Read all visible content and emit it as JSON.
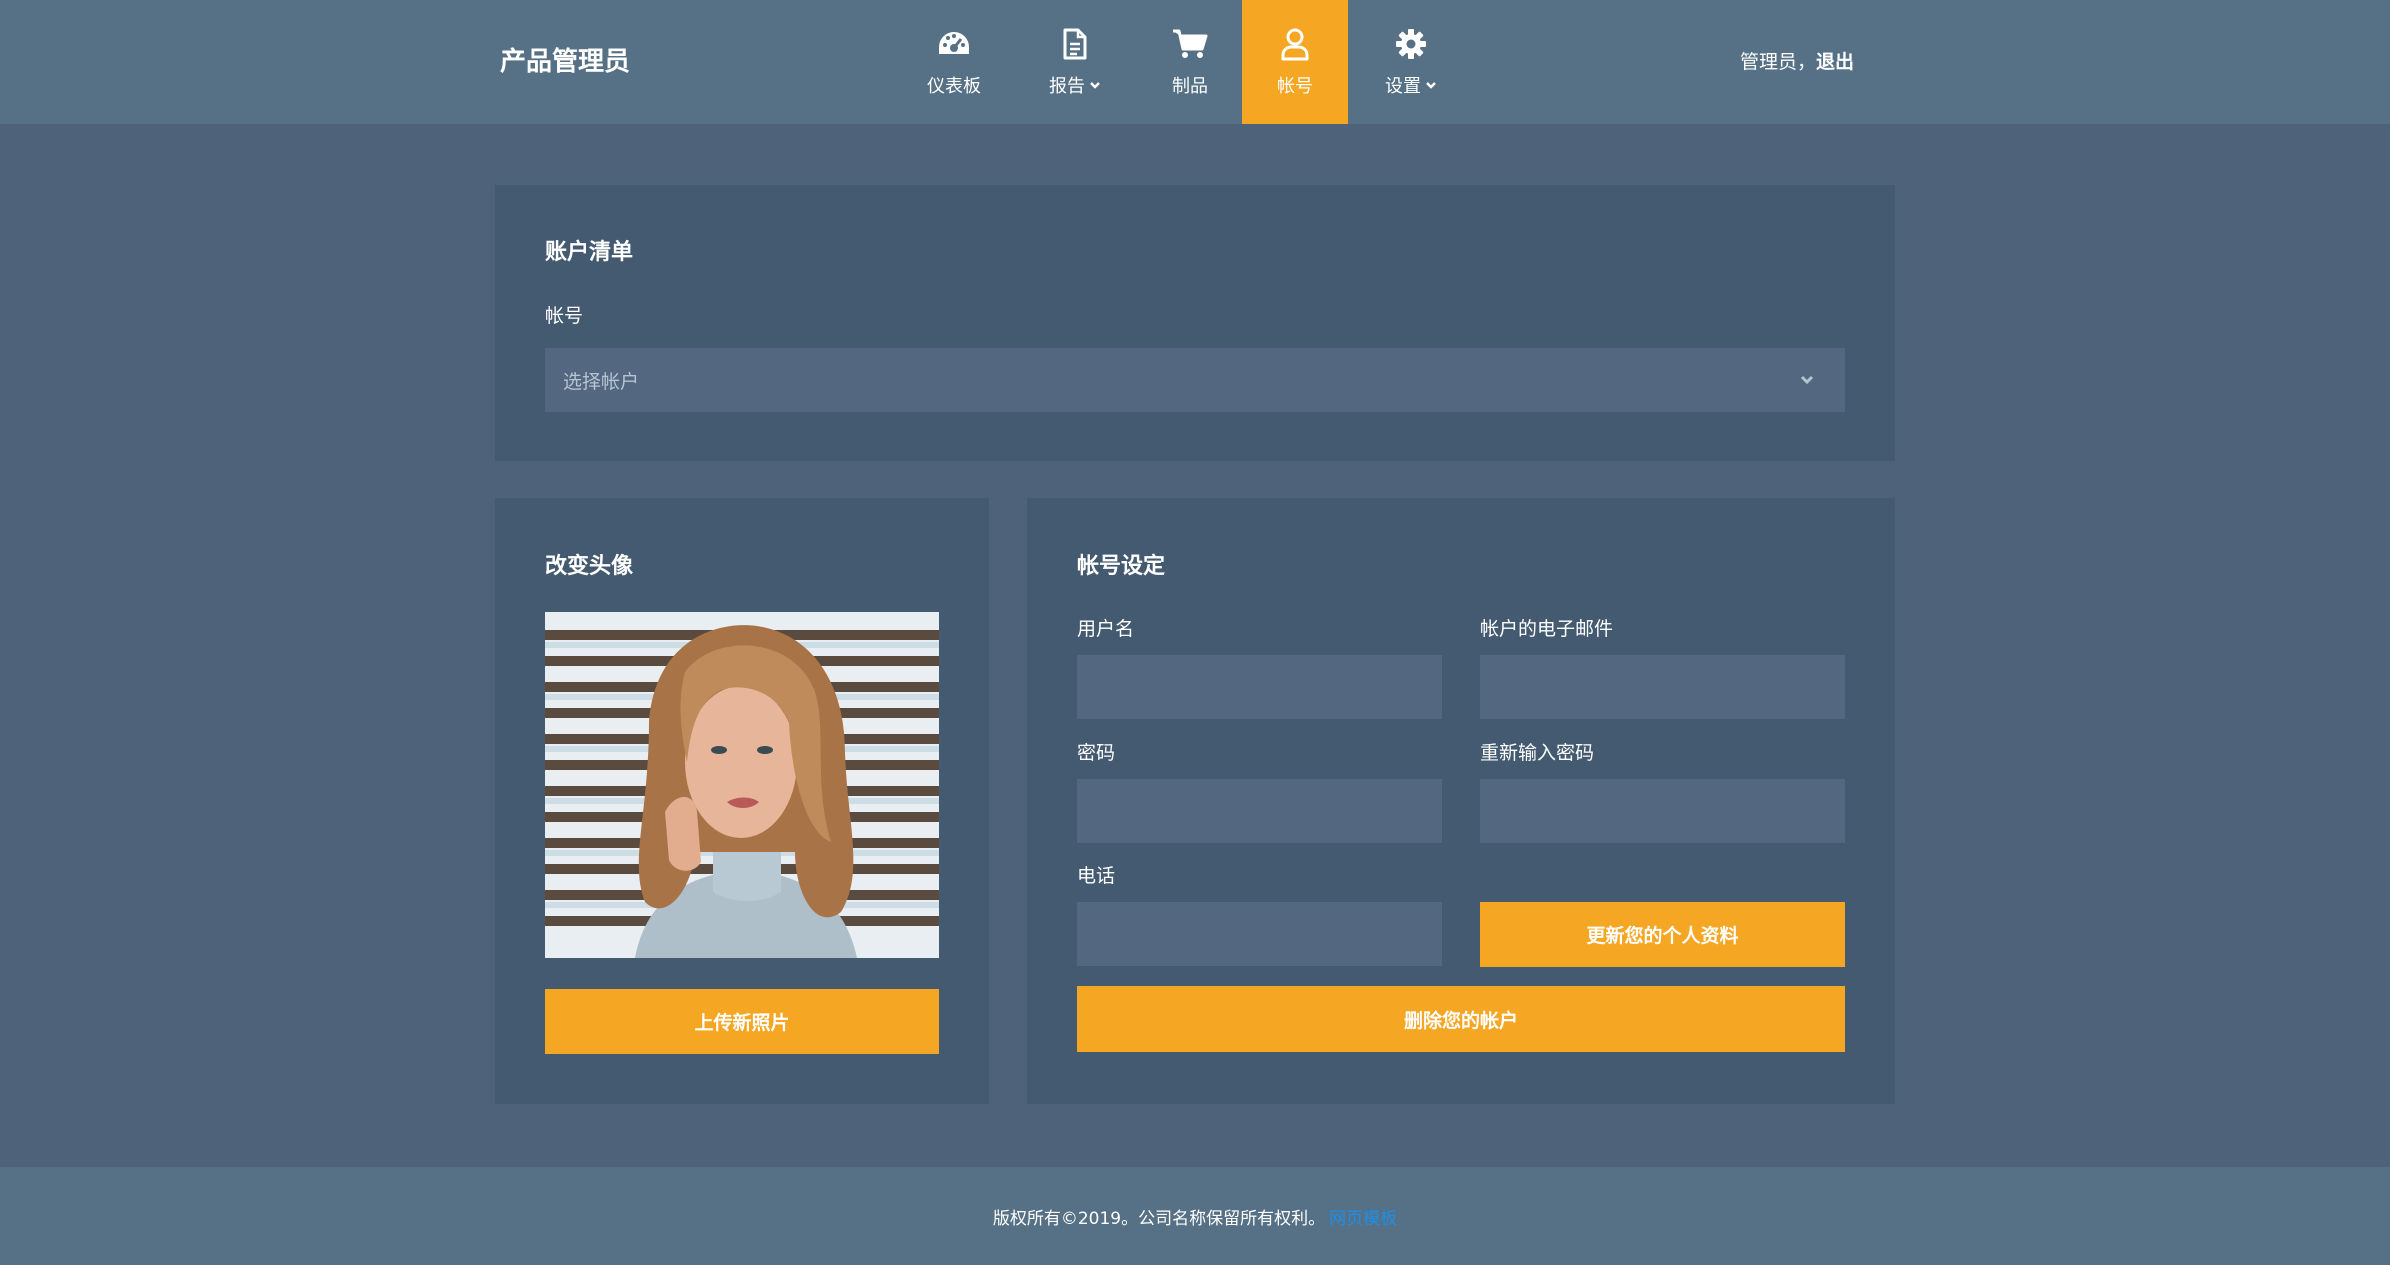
{
  "header": {
    "brand": "产品管理员",
    "nav": [
      {
        "label": "仪表板",
        "icon": "dashboard-gauge-icon"
      },
      {
        "label": "报告",
        "icon": "file-report-icon",
        "has_caret": true
      },
      {
        "label": "制品",
        "icon": "shopping-cart-icon"
      },
      {
        "label": "帐号",
        "icon": "user-account-icon",
        "active": true
      },
      {
        "label": "设置",
        "icon": "gear-icon",
        "has_caret": true
      }
    ],
    "user_greeting": "管理员，",
    "logout_label": "退出"
  },
  "account_list": {
    "title": "账户清单",
    "field_label": "帐号",
    "select_placeholder": "选择帐户"
  },
  "avatar_panel": {
    "title": "改变头像",
    "upload_label": "上传新照片"
  },
  "settings": {
    "title": "帐号设定",
    "username_label": "用户名",
    "email_label": "帐户的电子邮件",
    "password_label": "密码",
    "password_repeat_label": "重新输入密码",
    "phone_label": "电话",
    "update_label": "更新您的个人资料",
    "delete_label": "删除您的帐户"
  },
  "footer": {
    "copyright": "版权所有©2019。公司名称保留所有权利。",
    "link_label": "网页模板"
  },
  "colors": {
    "background": "#4e6379",
    "header": "#567086",
    "panel": "#435a70",
    "input": "#536781",
    "accent": "#f5a623",
    "link": "#1f8fe6"
  }
}
